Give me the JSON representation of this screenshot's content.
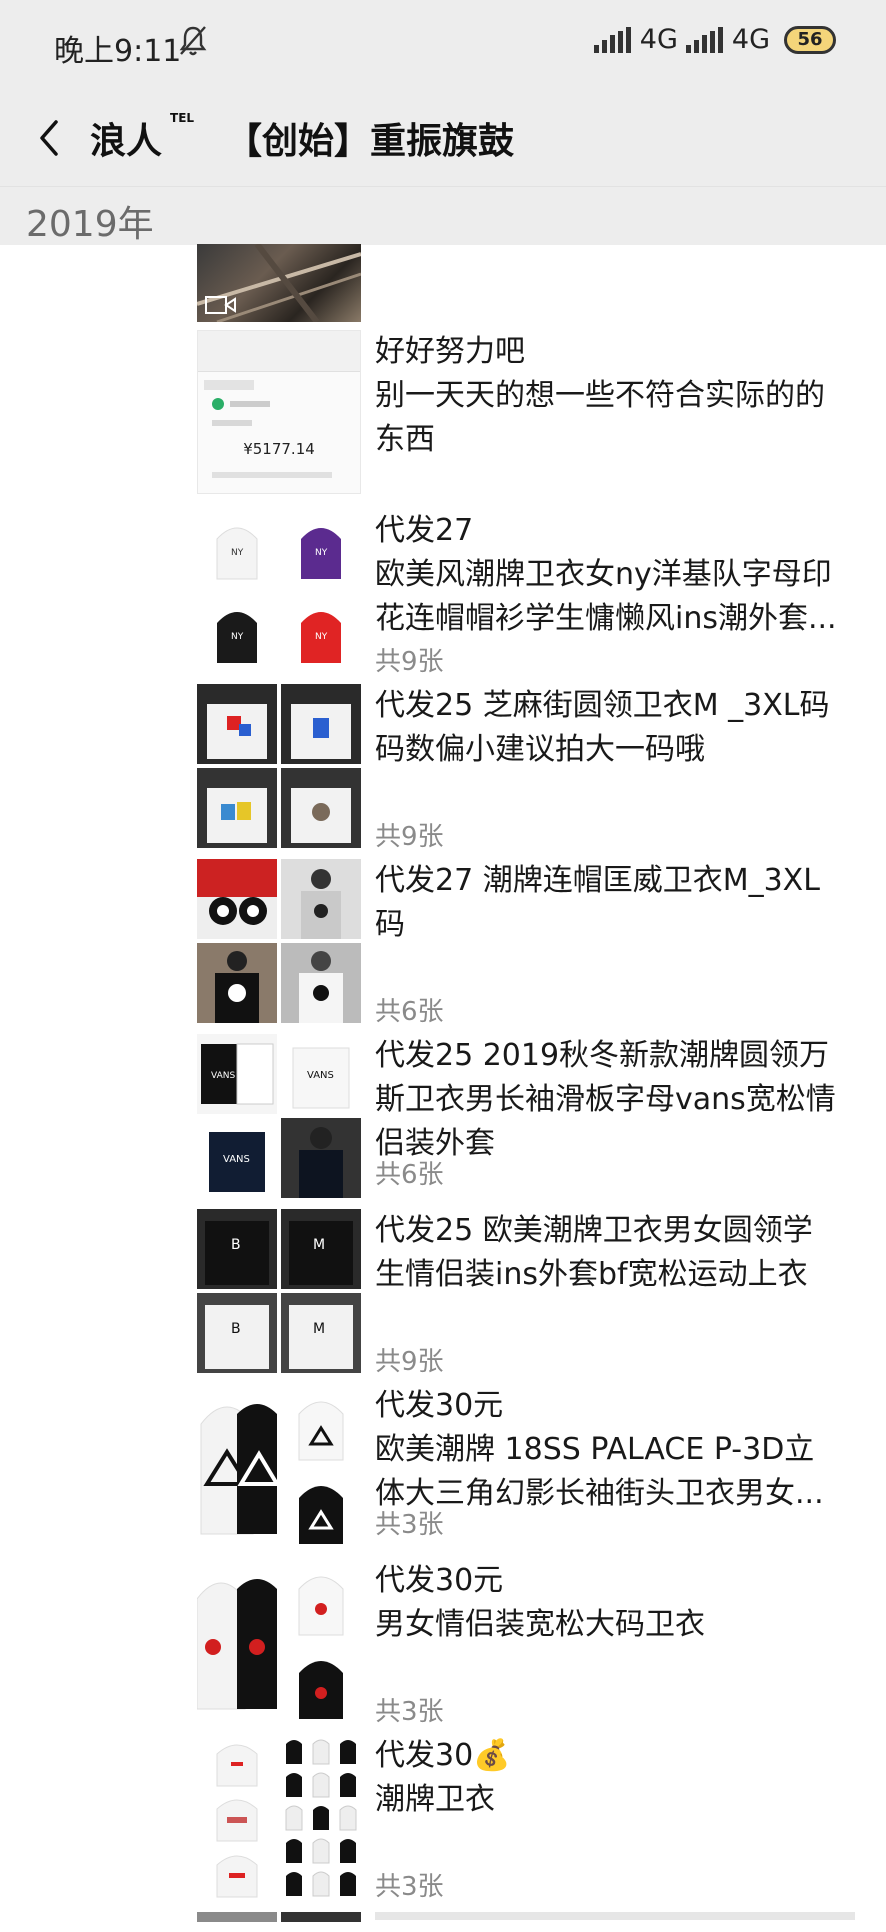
{
  "status_bar": {
    "time": "晚上9:11",
    "network_1": "4G",
    "network_2": "4G",
    "battery": "56"
  },
  "header": {
    "name": "浪人",
    "superscript": "TEL",
    "subtitle": "【创始】重振旗鼓"
  },
  "year_label": "2019年",
  "posts": [
    {
      "lines": [],
      "count": ""
    },
    {
      "lines": [
        "好好努力吧",
        "别一天天的想一些不符合实际的的",
        "东西"
      ],
      "count": "",
      "receipt": {
        "amount": "¥5177.14"
      }
    },
    {
      "lines": [
        "代发27",
        "欧美风潮牌卫衣女ny洋基队字母印",
        "花连帽帽衫学生慵懒风ins潮外套..."
      ],
      "count": "共9张"
    },
    {
      "lines": [
        "代发25 芝麻街圆领卫衣M _3XL码",
        "码数偏小建议拍大一码哦"
      ],
      "count": "共9张"
    },
    {
      "lines": [
        "代发27 潮牌连帽匡威卫衣M_3XL",
        "码"
      ],
      "count": "共6张"
    },
    {
      "lines": [
        "代发25 2019秋冬新款潮牌圆领万",
        "斯卫衣男长袖滑板字母vans宽松情",
        "侣装外套"
      ],
      "count": "共6张"
    },
    {
      "lines": [
        "代发25 欧美潮牌卫衣男女圆领学",
        "生情侣装ins外套bf宽松运动上衣"
      ],
      "count": "共9张"
    },
    {
      "lines": [
        "代发30元",
        "欧美潮牌 18SS PALACE P-3D立",
        "体大三角幻影长袖街头卫衣男女..."
      ],
      "count": "共3张"
    },
    {
      "lines": [
        "代发30元",
        "男女情侣装宽松大码卫衣"
      ],
      "count": "共3张"
    },
    {
      "lines": [
        "代发30💰",
        "潮牌卫衣"
      ],
      "count": "共3张"
    }
  ],
  "colors": {
    "header_bg": "#ededed",
    "secondary_text": "#8a8a8a"
  }
}
